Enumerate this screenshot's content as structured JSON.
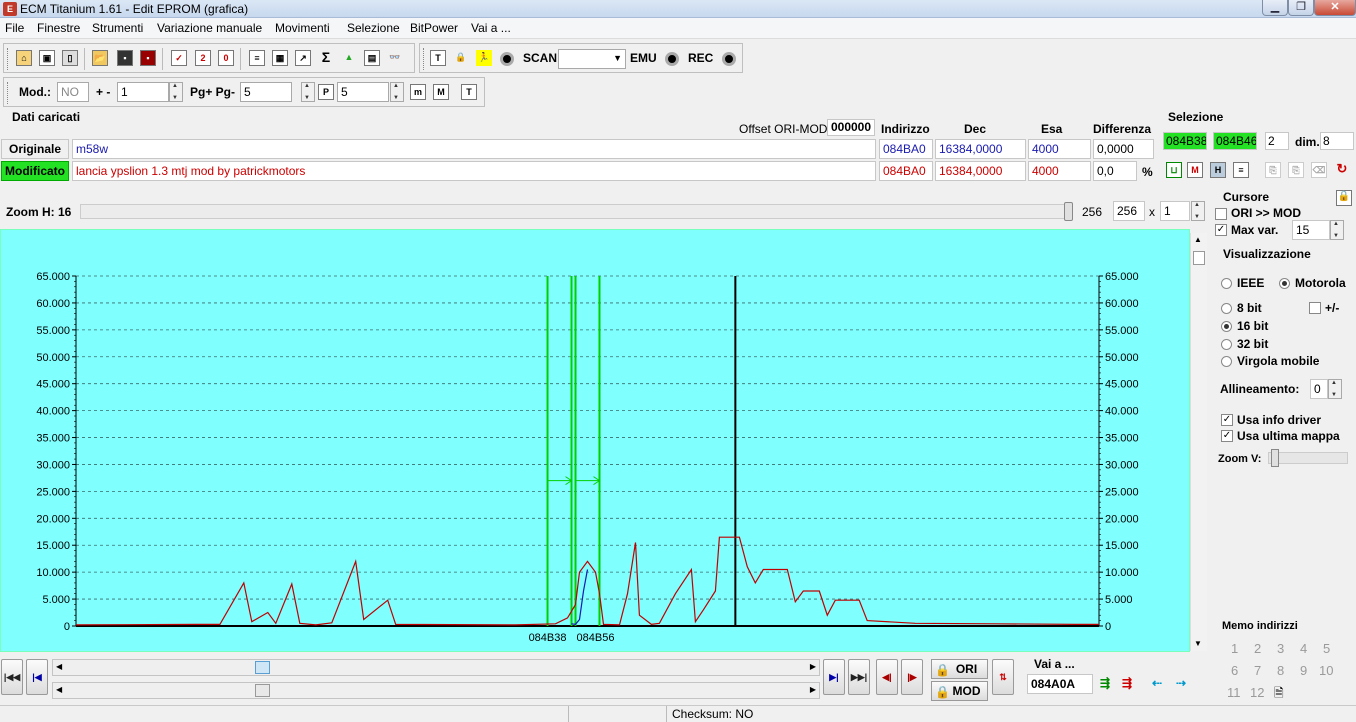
{
  "window": {
    "title": "ECM Titanium 1.61 - Edit EPROM (grafica)"
  },
  "menu": [
    "File",
    "Finestre",
    "Strumenti",
    "Variazione manuale",
    "Movimenti",
    "Selezione",
    "BitPower",
    "Vai a ..."
  ],
  "toolbar2": {
    "scan": "SCAN",
    "emu": "EMU",
    "rec": "REC"
  },
  "toolbar3": {
    "mod_label": "Mod.:",
    "mod_value": "NO",
    "plusminus": "+ -",
    "step_value": "1",
    "pg_label": "Pg+ Pg-",
    "pg_value": "5",
    "p_value": "5"
  },
  "data_panel": {
    "title": "Dati caricati",
    "offset_label": "Offset ORI-MOD",
    "offset_value": "000000",
    "col_indirizzo": "Indirizzo",
    "col_dec": "Dec",
    "col_esa": "Esa",
    "col_diff": "Differenza",
    "originale": {
      "label": "Originale",
      "name": "m58w",
      "addr": "084BA0",
      "dec": "16384,0000",
      "esa": "4000",
      "diff": "0,0000"
    },
    "modificato": {
      "label": "Modificato",
      "name": "lancia ypslion 1.3 mtj mod by patrickmotors",
      "addr": "084BA0",
      "dec": "16384,0000",
      "esa": "4000",
      "diff": "0,0",
      "pct": "%"
    }
  },
  "selezione": {
    "title": "Selezione",
    "start": "084B38",
    "end": "084B46",
    "count": "2",
    "dim_label": "dim.",
    "dim_value": "8"
  },
  "zoom": {
    "label": "Zoom H: 16",
    "value_a": "256",
    "value_b": "256",
    "x": "x",
    "mult": "1"
  },
  "cursore": {
    "title": "Cursore",
    "ori_mod": "ORI >> MOD",
    "max_var": "Max var.",
    "max_var_value": "15"
  },
  "visualizzazione": {
    "title": "Visualizzazione",
    "ieee": "IEEE",
    "motorola": "Motorola",
    "bit8": "8 bit",
    "plusminus": "+/-",
    "bit16": "16 bit",
    "bit32": "32 bit",
    "virgola": "Virgola mobile",
    "allineamento": "Allineamento:",
    "allineamento_value": "0",
    "usa_info": "Usa info driver",
    "usa_ultima": "Usa ultima mappa",
    "zoom_v": "Zoom V:"
  },
  "memo": {
    "title": "Memo indirizzi",
    "numbers": [
      "1",
      "2",
      "3",
      "4",
      "5",
      "6",
      "7",
      "8",
      "9",
      "10",
      "11",
      "12"
    ]
  },
  "bottom": {
    "ori": "ORI",
    "mod": "MOD",
    "vai_a": "Vai a ...",
    "vai_value": "084A0A"
  },
  "status": {
    "checksum": "Checksum: NO"
  },
  "chart_data": {
    "type": "line",
    "y_ticks": [
      "65.000",
      "60.000",
      "55.000",
      "50.000",
      "45.000",
      "40.000",
      "35.000",
      "30.000",
      "25.000",
      "20.000",
      "15.000",
      "10.000",
      "5.000",
      "0"
    ],
    "ylim": [
      0,
      65000
    ],
    "xlim": [
      0,
      256
    ],
    "x_labels": [
      {
        "x": 118,
        "text": "084B38"
      },
      {
        "x": 130,
        "text": "084B56"
      }
    ],
    "grid": true,
    "series": [
      {
        "color": "#c00000",
        "points": [
          [
            0,
            200
          ],
          [
            30,
            300
          ],
          [
            36,
            300
          ],
          [
            42,
            8000
          ],
          [
            44,
            800
          ],
          [
            48,
            2500
          ],
          [
            50,
            500
          ],
          [
            54,
            7800
          ],
          [
            56,
            500
          ],
          [
            60,
            200
          ],
          [
            64,
            600
          ],
          [
            70,
            12000
          ],
          [
            72,
            1200
          ],
          [
            78,
            4800
          ],
          [
            80,
            300
          ],
          [
            110,
            200
          ],
          [
            120,
            400
          ],
          [
            123,
            1500
          ],
          [
            125,
            4000
          ],
          [
            126,
            10000
          ],
          [
            128,
            12000
          ],
          [
            130,
            10000
          ],
          [
            131,
            6000
          ],
          [
            132,
            300
          ],
          [
            136,
            200
          ],
          [
            138,
            6000
          ],
          [
            140,
            15500
          ],
          [
            141,
            2000
          ],
          [
            144,
            300
          ],
          [
            146,
            500
          ],
          [
            150,
            6000
          ],
          [
            154,
            10500
          ],
          [
            155,
            800
          ],
          [
            157,
            3000
          ],
          [
            160,
            6500
          ],
          [
            161,
            16500
          ],
          [
            166,
            16500
          ],
          [
            168,
            11000
          ],
          [
            170,
            8000
          ],
          [
            172,
            10500
          ],
          [
            178,
            10500
          ],
          [
            180,
            4500
          ],
          [
            182,
            6500
          ],
          [
            186,
            6500
          ],
          [
            188,
            2000
          ],
          [
            190,
            4800
          ],
          [
            196,
            4800
          ],
          [
            198,
            1000
          ],
          [
            210,
            500
          ],
          [
            230,
            400
          ],
          [
            250,
            300
          ],
          [
            256,
            300
          ]
        ]
      },
      {
        "color": "#1a1ab0",
        "points": [
          [
            124,
            400
          ],
          [
            125,
            300
          ],
          [
            126,
            1200
          ],
          [
            127,
            6500
          ],
          [
            128,
            10500
          ]
        ]
      }
    ],
    "markers": [
      {
        "x": 118,
        "color": "#00d000"
      },
      {
        "x": 124,
        "color": "#00d000"
      },
      {
        "x": 125,
        "color": "#00d000"
      },
      {
        "x": 131,
        "color": "#00d000"
      },
      {
        "x": 165,
        "color": "#000000"
      }
    ]
  }
}
